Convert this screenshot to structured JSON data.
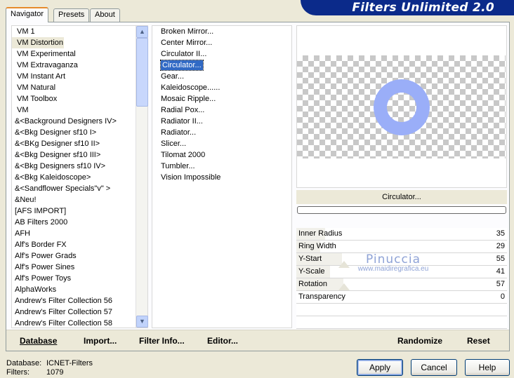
{
  "app_title": "Filters Unlimited 2.0",
  "tabs": [
    {
      "label": "Navigator",
      "active": true
    },
    {
      "label": "Presets",
      "active": false
    },
    {
      "label": "About",
      "active": false
    }
  ],
  "categories": [
    "VM 1",
    "VM Distortion",
    "VM Experimental",
    "VM Extravaganza",
    "VM Instant Art",
    "VM Natural",
    "VM Toolbox",
    "VM",
    "&<Background Designers IV>",
    "&<Bkg Designer sf10 I>",
    "&<BKg Designer sf10 II>",
    "&<Bkg Designer sf10 III>",
    "&<Bkg Designers sf10 IV>",
    "&<Bkg Kaleidoscope>",
    "&<Sandflower Specials\"v\" >",
    "&Neu!",
    "[AFS IMPORT]",
    "AB Filters 2000",
    "AFH",
    "Alf's Border FX",
    "Alf's Power Grads",
    "Alf's Power Sines",
    "Alf's Power Toys",
    "AlphaWorks",
    "Andrew's Filter Collection 56",
    "Andrew's Filter Collection 57",
    "Andrew's Filter Collection 58"
  ],
  "selected_category": "VM Distortion",
  "filters": [
    "Broken Mirror...",
    "Center Mirror...",
    "Circulator II...",
    "Circulator...",
    "Gear...",
    "Kaleidoscope......",
    "Mosaic Ripple...",
    "Radial Pox...",
    "Radiator II...",
    "Radiator...",
    "Slicer...",
    "Tilomat 2000",
    "Tumbler...",
    "Vision Impossible"
  ],
  "selected_filter": "Circulator...",
  "filter_name_display": "Circulator...",
  "params": [
    {
      "label": "Inner Radius",
      "value": "35",
      "fraction": 0.137
    },
    {
      "label": "Ring Width",
      "value": "29",
      "fraction": 0.114
    },
    {
      "label": "Y-Start",
      "value": "55",
      "fraction": 0.216
    },
    {
      "label": "Y-Scale",
      "value": "41",
      "fraction": 0.161
    },
    {
      "label": "Rotation",
      "value": "57",
      "fraction": 0.224
    },
    {
      "label": "Transparency",
      "value": "0",
      "fraction": 0.0
    }
  ],
  "watermark": {
    "line1": "Pinuccia",
    "line2": "www.maidiregrafica.eu"
  },
  "links": {
    "database": "Database",
    "import": "Import...",
    "filter_info": "Filter Info...",
    "editor": "Editor...",
    "randomize": "Randomize",
    "reset": "Reset"
  },
  "status": {
    "database_label": "Database:",
    "database_value": "ICNET-Filters",
    "filters_label": "Filters:",
    "filters_value": "1079"
  },
  "buttons": {
    "apply": "Apply",
    "cancel": "Cancel",
    "help": "Help"
  },
  "colors": {
    "banner": "#0b2a8a",
    "selection": "#316ac5",
    "ring": "#9aaef8"
  }
}
